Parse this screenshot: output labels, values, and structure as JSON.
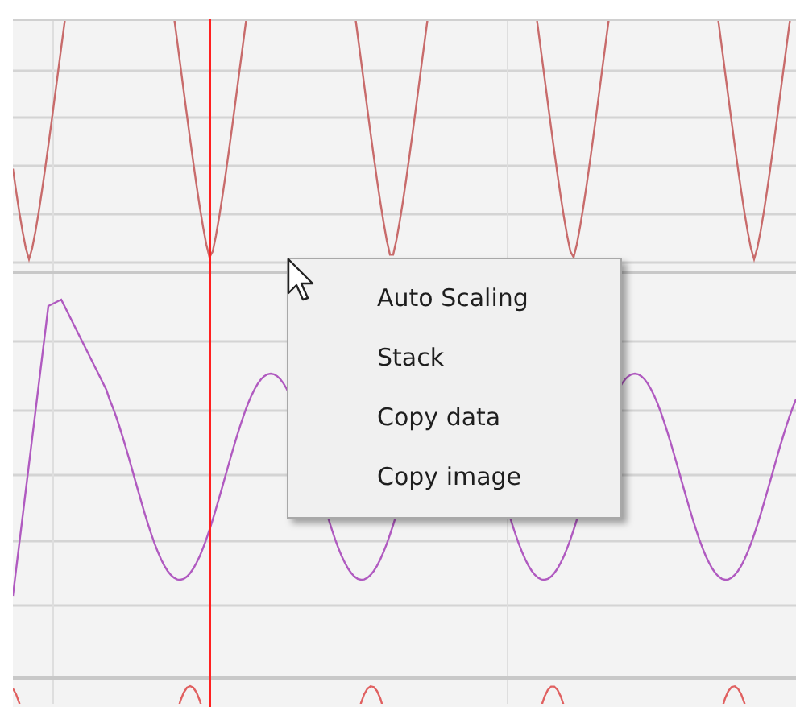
{
  "context_menu": {
    "items": [
      {
        "label": "Auto Scaling"
      },
      {
        "label": "Stack"
      },
      {
        "label": "Copy data"
      },
      {
        "label": "Copy image"
      }
    ]
  }
}
